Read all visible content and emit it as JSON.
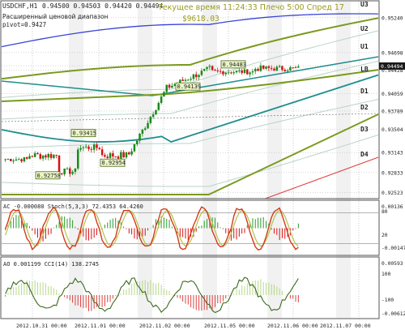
{
  "colors": {
    "background": "#ffffff",
    "frame": "#555555",
    "grid": "#bcbcbc",
    "text": "#222222",
    "band_outer_blue": "#3a43d6",
    "band_olive": "#7a9a1e",
    "band_light": "#b8d4c8",
    "red_band": "#e03c3c",
    "teal_ma": "#1f8e8e",
    "candle_up": "#1a8a1a",
    "candle_down": "#d01414",
    "price_box_bg": "#ecf6c8",
    "price_box_border": "#4a6a14",
    "ac_positive": "#2a9a2a",
    "ac_negative": "#d01414",
    "stoch_main": "#d43a1a",
    "stoch_signal": "#b3c24a",
    "cci_line": "#3a6a1a",
    "ao_bars": "#a6d06a",
    "night_stripes": "#e6e6e6"
  },
  "header": {
    "symbol": "USDCHF,H1",
    "ohlc": "0.94500 0.94503 0.94420 0.94494",
    "info_line1": "Расширенный ценовой диапазон",
    "info_line2": "pivot=0.9427",
    "current_time": "Текущее время 11:24:33 Плечо 5:00 Спред 17",
    "balance": "$9618.03"
  },
  "chart_data": [
    {
      "type": "candlestick",
      "series_name": "USDCHF,H1",
      "ylim": [
        0.9244,
        0.9549
      ],
      "y_ticks": [
        "0.95240",
        "0.94698",
        "0.94494",
        "0.94428",
        "0.94059",
        "0.93789",
        "0.93504",
        "0.93143",
        "0.92833",
        "0.92523"
      ],
      "x_ticks": [
        "2012.10.31 00:00",
        "2012.11.01 00:00",
        "2012.11.02 00:00",
        "2012.11.05 00:00",
        "2012.11.06 00:00",
        "2012.11.07 00:00"
      ],
      "price_labels": [
        {
          "label": "0.93415",
          "value": 0.93415
        },
        {
          "label": "0.92954",
          "value": 0.92954
        },
        {
          "label": "0.92758",
          "value": 0.92758
        },
        {
          "label": "0.94139",
          "value": 0.94139
        },
        {
          "label": "0.94483",
          "value": 0.94483
        }
      ],
      "level_labels": [
        "U3",
        "U2",
        "U1",
        "LB",
        "D1",
        "D2",
        "D3",
        "D4"
      ],
      "last_price": "0.94494"
    },
    {
      "type": "oscillator",
      "title": "AC -0.000080 Stoch(5,3,3) 72.4353 64.4260",
      "ylim": [
        0,
        100
      ],
      "levels": [
        80,
        20
      ],
      "y_ticks": [
        "0.00136",
        "80",
        "20",
        "-0.00147"
      ]
    },
    {
      "type": "oscillator",
      "title": "AO 0.001199 CCI(14) 138.2745",
      "y_ticks": [
        "0.00593",
        "100",
        "-100",
        "-0.00612"
      ]
    }
  ]
}
